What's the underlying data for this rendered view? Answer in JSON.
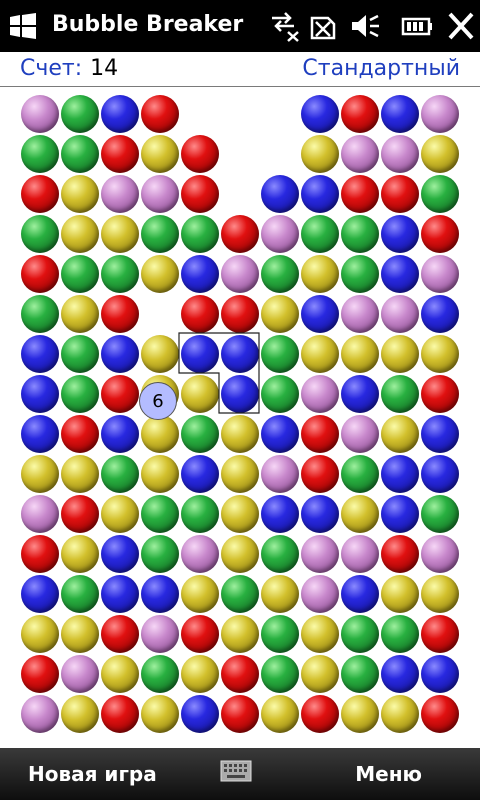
{
  "titlebar": {
    "title": "Bubble Breaker"
  },
  "status": {
    "score_label": "Счет:",
    "score_value": "14",
    "mode": "Стандартный"
  },
  "board": {
    "selected_count": "6",
    "rows": [
      [
        "P",
        "G",
        "B",
        "R",
        null,
        null,
        null,
        "B",
        "R",
        "B",
        "P"
      ],
      [
        "G",
        "G",
        "R",
        "Y",
        "R",
        null,
        null,
        "Y",
        "P",
        "P",
        "Y"
      ],
      [
        "R",
        "Y",
        "P",
        "P",
        "R",
        null,
        "B",
        "B",
        "R",
        "R",
        "G"
      ],
      [
        "G",
        "Y",
        "Y",
        "G",
        "G",
        "R",
        "P",
        "G",
        "G",
        "B",
        "R"
      ],
      [
        "R",
        "G",
        "G",
        "Y",
        "B",
        "P",
        "G",
        "Y",
        "G",
        "B",
        "P"
      ],
      [
        "G",
        "Y",
        "R",
        "*",
        "R",
        "R",
        "Y",
        "B",
        "P",
        "P",
        "B"
      ],
      [
        "B",
        "G",
        "B",
        "Y",
        "B",
        "B",
        "G",
        "Y",
        "Y",
        "Y",
        "Y"
      ],
      [
        "B",
        "G",
        "R",
        "Y",
        "Y",
        "B",
        "G",
        "P",
        "B",
        "G",
        "R"
      ],
      [
        "B",
        "R",
        "B",
        "Y",
        "G",
        "Y",
        "B",
        "R",
        "P",
        "Y",
        "B"
      ],
      [
        "Y",
        "Y",
        "G",
        "Y",
        "B",
        "Y",
        "P",
        "R",
        "G",
        "B",
        "B"
      ],
      [
        "P",
        "R",
        "Y",
        "G",
        "G",
        "Y",
        "B",
        "B",
        "Y",
        "B",
        "G"
      ],
      [
        "R",
        "Y",
        "B",
        "G",
        "P",
        "Y",
        "G",
        "P",
        "P",
        "R",
        "P"
      ],
      [
        "B",
        "G",
        "B",
        "B",
        "Y",
        "G",
        "Y",
        "P",
        "B",
        "Y",
        "Y"
      ],
      [
        "Y",
        "Y",
        "R",
        "P",
        "R",
        "Y",
        "G",
        "Y",
        "G",
        "G",
        "R"
      ],
      [
        "R",
        "P",
        "Y",
        "G",
        "Y",
        "R",
        "G",
        "Y",
        "G",
        "B",
        "B"
      ],
      [
        "P",
        "Y",
        "R",
        "Y",
        "B",
        "R",
        "Y",
        "R",
        "Y",
        "Y",
        "R"
      ]
    ]
  },
  "menubar": {
    "left_label": "Новая игра",
    "right_label": "Меню"
  },
  "colors": {
    "accent": "#1f3fbf"
  }
}
